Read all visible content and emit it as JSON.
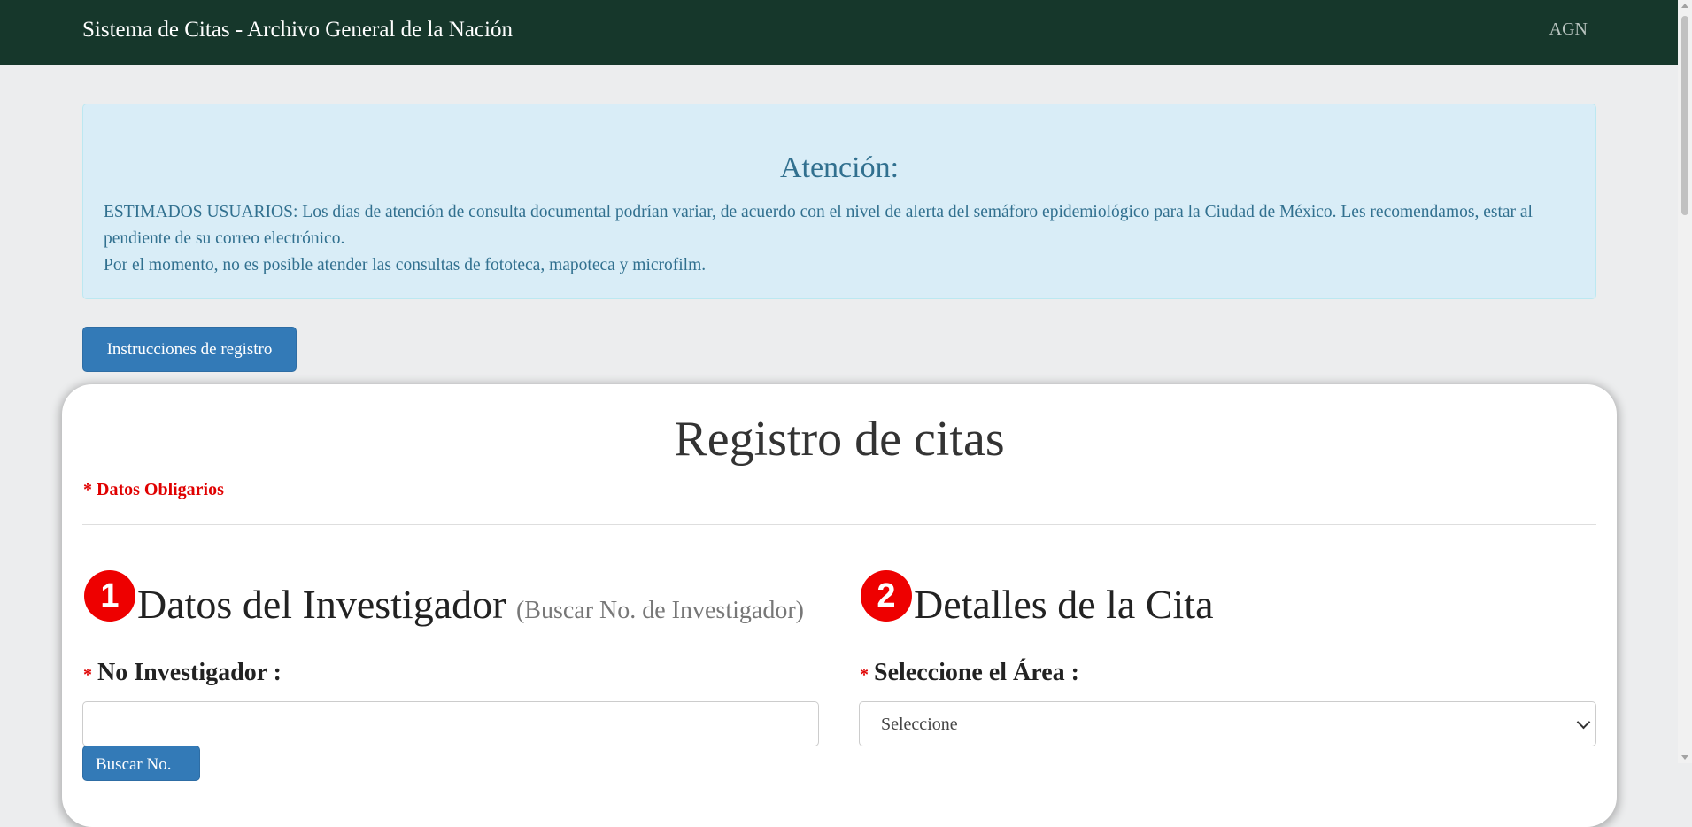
{
  "navbar": {
    "brand": "Sistema de Citas - Archivo General de la Nación",
    "right_link": "AGN"
  },
  "alert": {
    "title": "Atención:",
    "line1": "ESTIMADOS USUARIOS: Los días de atención de consulta documental podrían variar, de acuerdo con el nivel de alerta del semáforo epidemiológico para la Ciudad de México. Les recomendamos, estar al pendiente de su correo electrónico.",
    "line2": "Por el momento, no es posible atender las consultas de fototeca, mapoteca y microfilm."
  },
  "instructions_button": "Instrucciones de registro",
  "form": {
    "title": "Registro de citas",
    "required_note": "* Datos Obligarios",
    "section1": {
      "step": "1",
      "title": "Datos del Investigador",
      "subtitle": "(Buscar No. de Investigador)",
      "field_label": "No Investigador :",
      "field_value": "",
      "search_button": "Buscar No."
    },
    "section2": {
      "step": "2",
      "title": "Detalles de la Cita",
      "field_label": "Seleccione el Área :",
      "selected_option": "Seleccione"
    },
    "required_marker": "*"
  },
  "colors": {
    "navbar_bg": "#16372b",
    "alert_bg": "#d9edf7",
    "alert_text": "#31708f",
    "primary": "#337ab7",
    "required": "#e00000"
  }
}
